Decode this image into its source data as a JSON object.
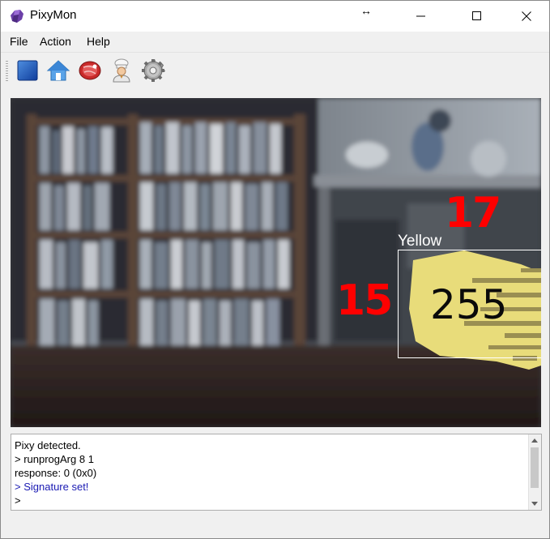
{
  "window": {
    "title": "PixyMon"
  },
  "menu": {
    "items": [
      "File",
      "Action",
      "Help"
    ]
  },
  "toolbar": {
    "tools": [
      {
        "icon": "stop-icon"
      },
      {
        "icon": "home-icon"
      },
      {
        "icon": "raw-video-icon"
      },
      {
        "icon": "chef-icon"
      },
      {
        "icon": "gear-icon"
      }
    ]
  },
  "video": {
    "block_label": "Yellow",
    "block_value": "255",
    "annotations": [
      "17",
      "15"
    ],
    "colors": {
      "box": "#ffffff",
      "annotation": "#ff0000",
      "block_fill": "#e8dc7a"
    }
  },
  "console": {
    "lines": [
      {
        "text": "Pixy detected.",
        "color": "black"
      },
      {
        "text": "> runprogArg 8 1",
        "color": "black"
      },
      {
        "text": "response: 0 (0x0)",
        "color": "black"
      },
      {
        "text": "> Signature set!",
        "color": "blue"
      },
      {
        "text": ">",
        "color": "black"
      }
    ]
  }
}
